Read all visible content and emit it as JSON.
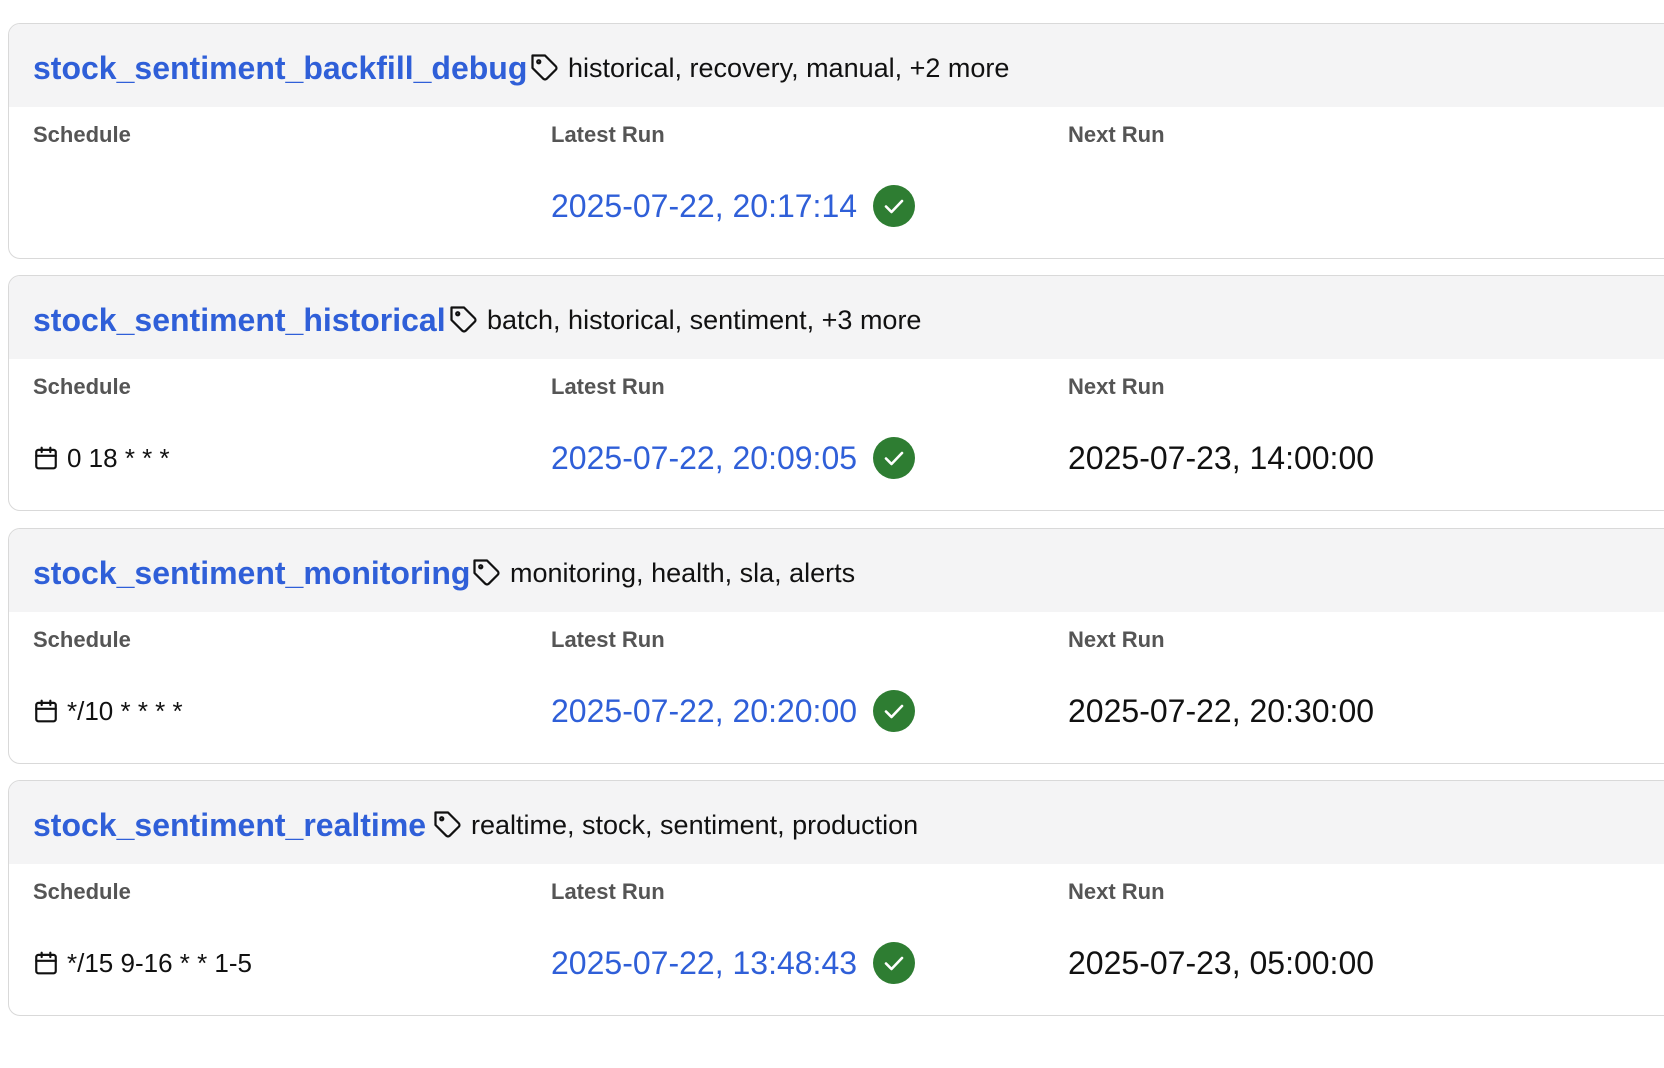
{
  "dags": [
    {
      "name": "stock_sentiment_backfill_debug",
      "tags": "historical, recovery, manual, +2 more",
      "schedule_label": "Schedule",
      "latest_run_label": "Latest Run",
      "next_run_label": "Next Run",
      "schedule": "",
      "latest_run": "2025-07-22, 20:17:14",
      "latest_status": "success",
      "next_run": ""
    },
    {
      "name": "stock_sentiment_historical",
      "tags": "batch, historical, sentiment, +3 more",
      "schedule_label": "Schedule",
      "latest_run_label": "Latest Run",
      "next_run_label": "Next Run",
      "schedule": "0 18 * * *",
      "latest_run": "2025-07-22, 20:09:05",
      "latest_status": "success",
      "next_run": "2025-07-23, 14:00:00"
    },
    {
      "name": "stock_sentiment_monitoring",
      "tags": "monitoring, health, sla, alerts",
      "schedule_label": "Schedule",
      "latest_run_label": "Latest Run",
      "next_run_label": "Next Run",
      "schedule": "*/10 * * * *",
      "latest_run": "2025-07-22, 20:20:00",
      "latest_status": "success",
      "next_run": "2025-07-22, 20:30:00"
    },
    {
      "name": "stock_sentiment_realtime",
      "tags": "realtime, stock, sentiment, production",
      "schedule_label": "Schedule",
      "latest_run_label": "Latest Run",
      "next_run_label": "Next Run",
      "schedule": "*/15 9-16 * * 1-5",
      "latest_run": "2025-07-22, 13:48:43",
      "latest_status": "success",
      "next_run": "2025-07-23, 05:00:00"
    }
  ],
  "icons": {
    "tag": "tag-icon",
    "schedule": "calendar-icon",
    "status_success": "check-circle-icon"
  },
  "colors": {
    "link": "#2f5fd8",
    "success": "#2e7d32",
    "header_bg": "#f4f4f5",
    "border": "#d9d9d9"
  }
}
